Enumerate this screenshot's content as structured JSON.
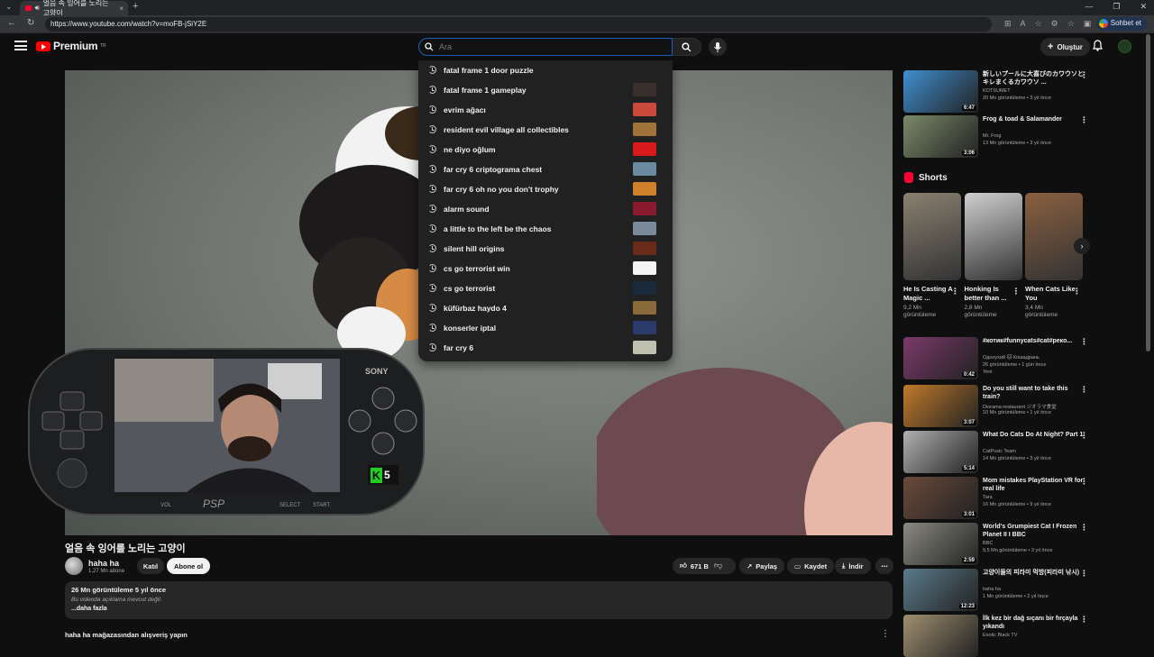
{
  "browser": {
    "tab_title": "얼음 속 잉어를 노리는 고양이",
    "url": "https://www.youtube.com/watch?v=moFB-jSiY2E",
    "chat_button": "Sohbet et"
  },
  "header": {
    "logo_text": "Premium",
    "logo_sup": "TR",
    "search_placeholder": "Ara",
    "create_label": "Oluştur"
  },
  "suggestions": [
    {
      "text": "fatal frame 1 door puzzle",
      "thumb": ""
    },
    {
      "text": "fatal frame 1 gameplay",
      "thumb": "#3a2f2a"
    },
    {
      "text": "evrim ağacı",
      "thumb": "#c94a3a"
    },
    {
      "text": "resident evil village all collectibles",
      "thumb": "#a0733a"
    },
    {
      "text": "ne diyo oğlum",
      "thumb": "#d81a1a"
    },
    {
      "text": "far cry 6 criptograma chest",
      "thumb": "#6a8aa0"
    },
    {
      "text": "far cry 6 oh no you don't trophy",
      "thumb": "#d0802a"
    },
    {
      "text": "alarm sound",
      "thumb": "#8a1a30"
    },
    {
      "text": "a little to the left be the chaos",
      "thumb": "#7a8a9a"
    },
    {
      "text": "silent hill origins",
      "thumb": "#6a2a1a"
    },
    {
      "text": "cs go terrorist win",
      "thumb": "#f5f5f5"
    },
    {
      "text": "cs go terrorist",
      "thumb": "#1a2a3a"
    },
    {
      "text": "küfürbaz haydo 4",
      "thumb": "#8a6a3a"
    },
    {
      "text": "konserler iptal",
      "thumb": "#2a3a6a"
    },
    {
      "text": "far cry 6",
      "thumb": "#c0c0b0"
    }
  ],
  "video": {
    "title": "얼음 속 잉어를 노리는 고양이",
    "channel": "haha ha",
    "subs": "1,27 Mn abone",
    "join_label": "Katıl",
    "subscribe_label": "Abone ol",
    "likes": "671 B",
    "share_label": "Paylaş",
    "save_label": "Kaydet",
    "download_label": "İndir",
    "views_time": "26 Mn görüntüleme  5 yıl önce",
    "desc_note": "Bu videoda açıklama mevcut değil.",
    "more_label": "...daha fazla",
    "store_label": "haha ha mağazasından alışveriş yapın",
    "psp_brand": "SONY",
    "psp_logo": "PSP",
    "psp_vol": "VOL",
    "psp_select": "SELECT",
    "psp_start": "START",
    "badge_letter": "K",
    "badge_number": "5"
  },
  "related_top": [
    {
      "title": "新しいプールに大喜びのカワウソとキレまくるカワウソ   ...",
      "channel": "KOTSUMET",
      "meta": "20 Mn görüntüleme • 3 yıl önce",
      "duration": "6:47",
      "color": "#3f8fd0"
    },
    {
      "title": "Frog & toad & Salamander",
      "channel": "Mr. Frog",
      "meta": "13 Mn görüntüleme • 3 yıl önce",
      "duration": "3:06",
      "color": "#7a8a6a"
    }
  ],
  "shorts": {
    "heading": "Shorts",
    "items": [
      {
        "title": "He Is Casting A Magic ...",
        "views": "9,2 Mn görüntüleme",
        "color": "#8a8070"
      },
      {
        "title": "Honking Is better than ...",
        "views": "2,8 Mn görüntüleme",
        "color": "#cfcfcf"
      },
      {
        "title": "When Cats Like You",
        "views": "3,4 Mn görüntüleme",
        "color": "#8a6040"
      }
    ]
  },
  "related": [
    {
      "title": "#котик#funnycats#cat#реко...",
      "channel": "Одноухий 🐱 Кошадрань",
      "meta": "26 görüntüleme • 1 gün önce",
      "badge": "Yeni",
      "duration": "0:42",
      "color": "#7a3a6a"
    },
    {
      "title": "Do you still want to take this train?",
      "channel": "Diorama restaurant ジオラマ食堂",
      "meta": "10 Mn görüntüleme • 1 yıl önce",
      "badge": "",
      "duration": "3:07",
      "color": "#c07a2a"
    },
    {
      "title": "What Do Cats Do At Night? Part 1",
      "channel": "CatPusic Team",
      "meta": "14 Mn görüntüleme • 3 yıl önce",
      "badge": "",
      "duration": "5:14",
      "color": "#b0b0b0"
    },
    {
      "title": "Mom mistakes PlayStation VR for real life",
      "channel": "Tara",
      "meta": "16 Mn görüntüleme • 9 yıl önce",
      "badge": "",
      "duration": "3:01",
      "color": "#6a4a3a"
    },
    {
      "title": "World's Grumpiest Cat I Frozen Planet II I BBC",
      "channel": "BBC",
      "meta": "9,5 Mn görüntüleme • 3 yıl önce",
      "badge": "",
      "duration": "2:59",
      "color": "#8a8a80"
    },
    {
      "title": "고양이들의 피라미 먹방(피라미 낚시)",
      "channel": "haha ha",
      "meta": "1 Mn görüntüleme • 2 yıl önce",
      "badge": "",
      "duration": "12:23",
      "color": "#5a7a8a"
    },
    {
      "title": "İlk kez bir dağ sıçanı bir fırçayla yıkandı",
      "channel": "Exotic Black TV",
      "meta": "",
      "badge": "",
      "duration": "",
      "color": "#a09070"
    }
  ]
}
